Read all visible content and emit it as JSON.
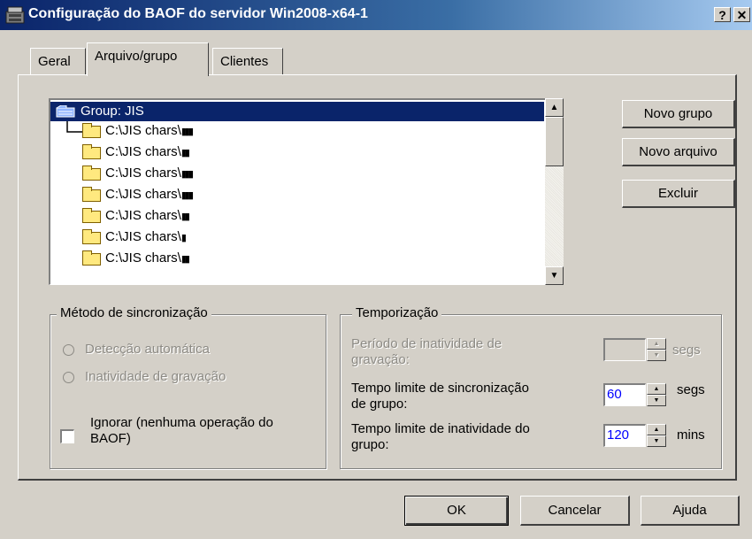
{
  "window": {
    "title": "Configuração do BAOF do servidor Win2008-x64-1",
    "help_button": "?",
    "close_button": "✕"
  },
  "tabs": [
    {
      "label": "Geral"
    },
    {
      "label": "Arquivo/grupo"
    },
    {
      "label": "Clientes"
    }
  ],
  "list": {
    "group": "Group: JIS",
    "items": [
      {
        "path": "C:\\JIS chars\\",
        "glyph": "▮▮▮"
      },
      {
        "path": "C:\\JIS chars\\",
        "glyph": "▮▮"
      },
      {
        "path": "C:\\JIS chars\\",
        "glyph": "▮▮▮"
      },
      {
        "path": "C:\\JIS chars\\",
        "glyph": "▮▮▮"
      },
      {
        "path": "C:\\JIS chars\\",
        "glyph": "▮▮"
      },
      {
        "path": "C:\\JIS chars\\",
        "glyph": "▮"
      },
      {
        "path": "C:\\JIS chars\\",
        "glyph": "▮▮"
      }
    ]
  },
  "side_buttons": {
    "new_group": "Novo grupo",
    "new_file": "Novo arquivo",
    "delete": "Excluir"
  },
  "sync_method": {
    "legend": "Método de sincronização",
    "auto_detect": "Detecção automática",
    "write_inactivity": "Inatividade de gravação",
    "ignore_line1": "Ignorar (nenhuma operação do",
    "ignore_line2": "BAOF)"
  },
  "timing": {
    "legend": "Temporização",
    "inactivity_period_line1": "Período de inatividade de",
    "inactivity_period_line2": "gravação:",
    "inactivity_period_value": "",
    "inactivity_period_unit": "segs",
    "group_sync_timeout_line1": "Tempo limite de sincronização",
    "group_sync_timeout_line2": "de grupo:",
    "group_sync_timeout_value": "60",
    "group_sync_timeout_unit": "segs",
    "group_inactivity_timeout_line1": "Tempo limite de inatividade do",
    "group_inactivity_timeout_line2": "grupo:",
    "group_inactivity_timeout_value": "120",
    "group_inactivity_timeout_unit": "mins"
  },
  "footer": {
    "ok": "OK",
    "cancel": "Cancelar",
    "help": "Ajuda"
  }
}
